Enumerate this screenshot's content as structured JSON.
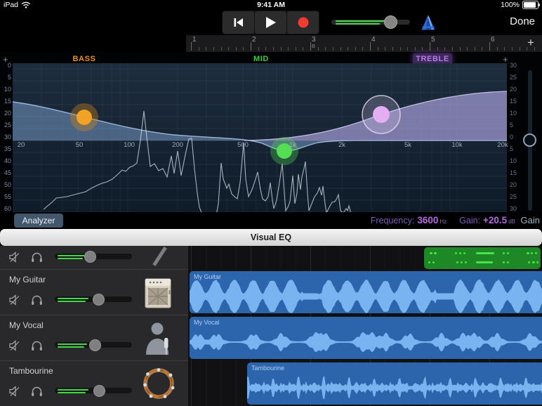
{
  "status_bar": {
    "device": "iPad",
    "time": "9:41 AM",
    "battery_percent": "100%"
  },
  "toolbar": {
    "done_label": "Done"
  },
  "ruler": {
    "bars": [
      "1",
      "2",
      "3",
      "4",
      "5",
      "6"
    ],
    "section_label": "B",
    "add_label": "+"
  },
  "eq": {
    "band_bass": "BASS",
    "band_mid": "MID",
    "band_treble": "TREBLE",
    "selected_band": "TREBLE",
    "add_left": "+",
    "add_right": "+",
    "left_axis": [
      "0",
      "5",
      "10",
      "15",
      "20",
      "25",
      "30",
      "35",
      "40",
      "45",
      "50",
      "55",
      "60"
    ],
    "right_axis": [
      "30",
      "25",
      "20",
      "15",
      "10",
      "5",
      "0",
      "5",
      "10",
      "15",
      "20",
      "25",
      "30"
    ],
    "freq_labels": [
      "20",
      "50",
      "100",
      "200",
      "500",
      "1k",
      "2k",
      "5k",
      "10k",
      "20k"
    ],
    "analyzer_label": "Analyzer",
    "frequency_label": "Frequency:",
    "frequency_value": "3600",
    "frequency_unit": "Hz",
    "gain_label": "Gain:",
    "gain_value": "+20.5",
    "gain_unit": "dB",
    "gain_slider_label": "Gain",
    "colors": {
      "bass": "#e8920d",
      "mid": "#3fc93f",
      "treble": "#bd76ef",
      "fill_blue": "#7da0cd",
      "fill_purple": "#a79fd8",
      "dot_bass": "#f2a224",
      "dot_mid": "#55dd55",
      "dot_treble": "#e4aef2"
    }
  },
  "sheet_title": "Visual EQ",
  "tracks": {
    "items": [
      {
        "name": ""
      },
      {
        "name": "My Guitar"
      },
      {
        "name": "My Vocal"
      },
      {
        "name": "Tambourine"
      }
    ]
  }
}
